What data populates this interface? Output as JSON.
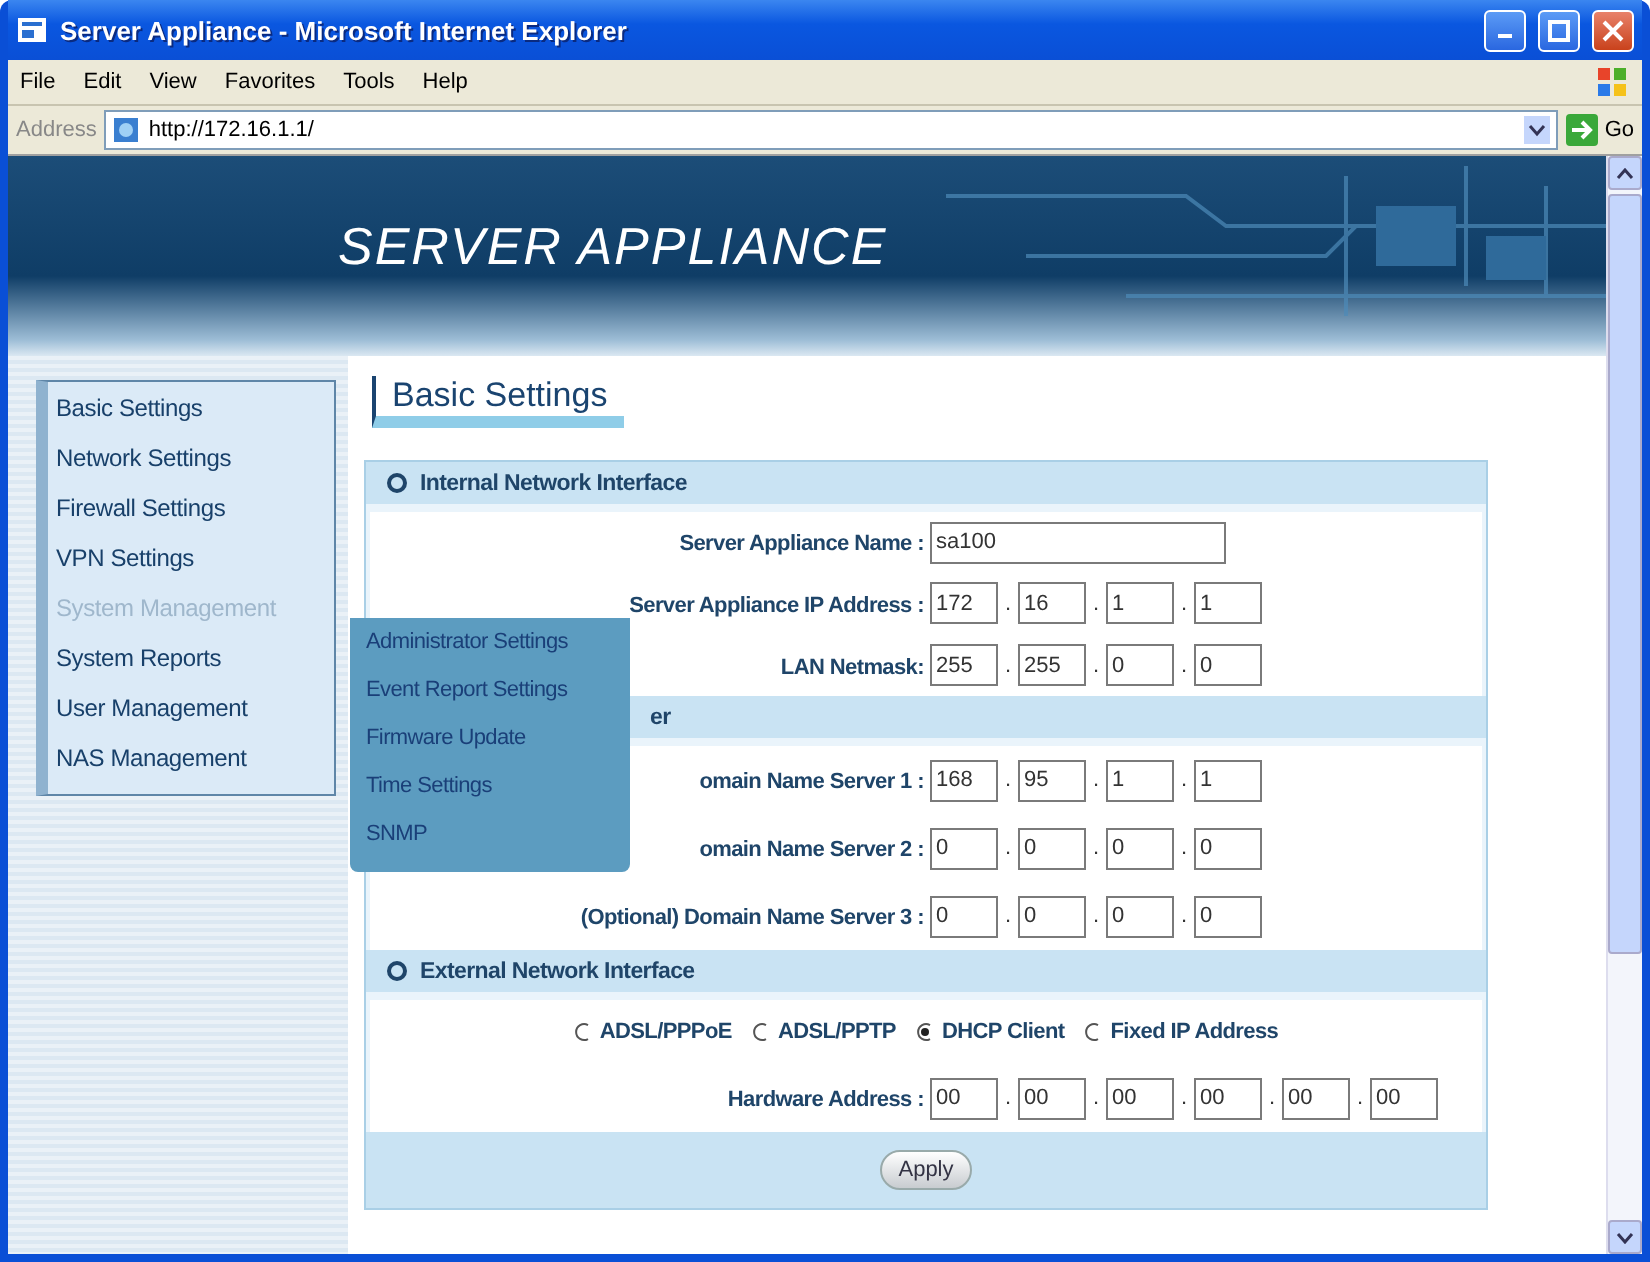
{
  "window": {
    "title": "Server Appliance - Microsoft Internet Explorer"
  },
  "menu_bar": [
    "File",
    "Edit",
    "View",
    "Favorites",
    "Tools",
    "Help"
  ],
  "address_bar": {
    "label": "Address",
    "url": "http://172.16.1.1/",
    "go": "Go"
  },
  "banner": {
    "title": "SERVER APPLIANCE"
  },
  "sidebar": {
    "items": [
      {
        "label": "Basic Settings",
        "selected": false
      },
      {
        "label": "Network Settings",
        "selected": false
      },
      {
        "label": "Firewall Settings",
        "selected": false
      },
      {
        "label": "VPN Settings",
        "selected": false
      },
      {
        "label": "System Management",
        "selected": true,
        "children": [
          {
            "label": "Administrator Settings"
          },
          {
            "label": "Event Report Settings"
          },
          {
            "label": "Firmware Update"
          },
          {
            "label": "Time Settings"
          },
          {
            "label": "SNMP"
          }
        ]
      },
      {
        "label": "System Reports",
        "selected": false
      },
      {
        "label": "User Management",
        "selected": false
      },
      {
        "label": "NAS Management",
        "selected": false
      }
    ]
  },
  "page_heading": "Basic Settings",
  "sections": [
    {
      "title": "Internal Network Interface",
      "icon": true,
      "rows": [
        {
          "kind": "text",
          "label": "Server Appliance Name :",
          "value": "sa100"
        },
        {
          "kind": "octets",
          "label": "Server Appliance IP Address :",
          "separator": ".",
          "values": [
            "172",
            "16",
            "1",
            "1"
          ]
        },
        {
          "kind": "octets",
          "label": "LAN Netmask:",
          "separator": ".",
          "values": [
            "255",
            "255",
            "0",
            "0"
          ]
        }
      ]
    },
    {
      "title": "er",
      "icon": false,
      "rows": [
        {
          "kind": "octets",
          "label": "omain Name Server 1 :",
          "separator": ".",
          "values": [
            "168",
            "95",
            "1",
            "1"
          ]
        },
        {
          "kind": "octets",
          "label": "omain Name Server 2 :",
          "separator": ".",
          "values": [
            "0",
            "0",
            "0",
            "0"
          ]
        },
        {
          "kind": "octets",
          "label": "(Optional) Domain Name Server 3 :",
          "separator": ".",
          "values": [
            "0",
            "0",
            "0",
            "0"
          ]
        }
      ]
    },
    {
      "title": "External Network Interface",
      "icon": true,
      "rows": [
        {
          "kind": "radios",
          "options": [
            {
              "label": "ADSL/PPPoE",
              "selected": false
            },
            {
              "label": "ADSL/PPTP",
              "selected": false
            },
            {
              "label": "DHCP Client",
              "selected": true
            },
            {
              "label": "Fixed IP Address",
              "selected": false
            }
          ]
        },
        {
          "kind": "octets",
          "label": "Hardware Address :",
          "separator": ".",
          "values": [
            "00",
            "00",
            "00",
            "00",
            "00",
            "00"
          ]
        }
      ]
    }
  ],
  "apply_button": "Apply"
}
